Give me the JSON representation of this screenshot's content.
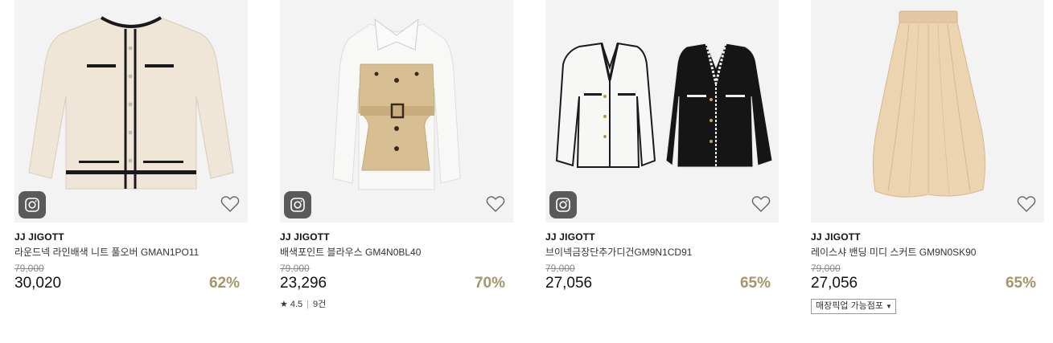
{
  "products": [
    {
      "brand": "JJ JIGOTT",
      "name": "라운드넥 라인배색 니트 풀오버 GMAN1PO11",
      "original_price": "79,000",
      "price": "30,020",
      "discount": "62%",
      "has_instagram": true
    },
    {
      "brand": "JJ JIGOTT",
      "name": "배색포인트 블라우스 GM4N0BL40",
      "original_price": "79,000",
      "price": "23,296",
      "discount": "70%",
      "has_instagram": true,
      "rating": "4.5",
      "review_count": "9건"
    },
    {
      "brand": "JJ JIGOTT",
      "name": "브이넥금장단추가디건GM9N1CD91",
      "original_price": "79,000",
      "price": "27,056",
      "discount": "65%",
      "has_instagram": true
    },
    {
      "brand": "JJ JIGOTT",
      "name": "레이스샤 밴딩 미디 스커트 GM9N0SK90",
      "original_price": "79,000",
      "price": "27,056",
      "discount": "65%",
      "has_instagram": false,
      "pickup_label": "매장픽업 가능점포"
    }
  ],
  "colors": {
    "discount": "#a8946a",
    "thumb_bg": "#f3f3f3",
    "instagram_badge": "#5a5a5a"
  },
  "icons": {
    "instagram": "instagram-icon",
    "wishlist": "heart-outline-icon",
    "rating": "star-icon",
    "dropdown": "caret-down-icon"
  }
}
